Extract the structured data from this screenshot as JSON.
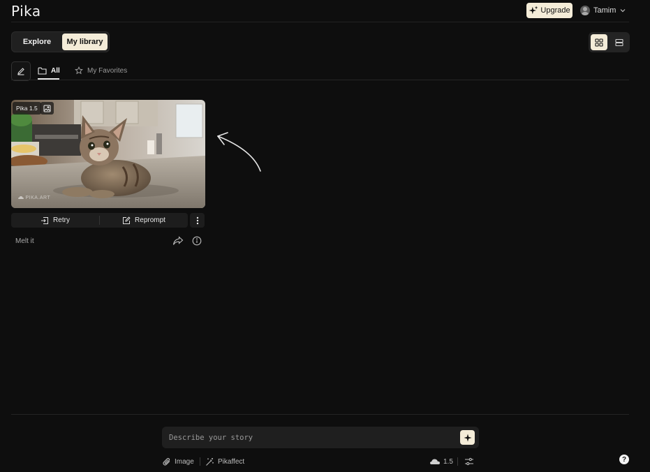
{
  "app": {
    "logo": "Pika"
  },
  "header": {
    "upgrade_label": "Upgrade",
    "username": "Tamim"
  },
  "nav": {
    "explore_label": "Explore",
    "library_label": "My library",
    "active": "My library"
  },
  "tabs": {
    "all_label": "All",
    "favorites_label": "My Favorites",
    "active": "All"
  },
  "card": {
    "model_badge": "Pika 1.5",
    "watermark": "PIKA.ART",
    "retry_label": "Retry",
    "reprompt_label": "Reprompt",
    "prompt_text": "Melt it"
  },
  "composer": {
    "placeholder": "Describe your story",
    "image_label": "Image",
    "pikaffect_label": "Pikaffect",
    "model_version": "1.5"
  },
  "help": {
    "label": "?"
  },
  "colors": {
    "background": "#0e0e0e",
    "accent": "#f4ecd8",
    "panel": "#1f1f1f"
  }
}
